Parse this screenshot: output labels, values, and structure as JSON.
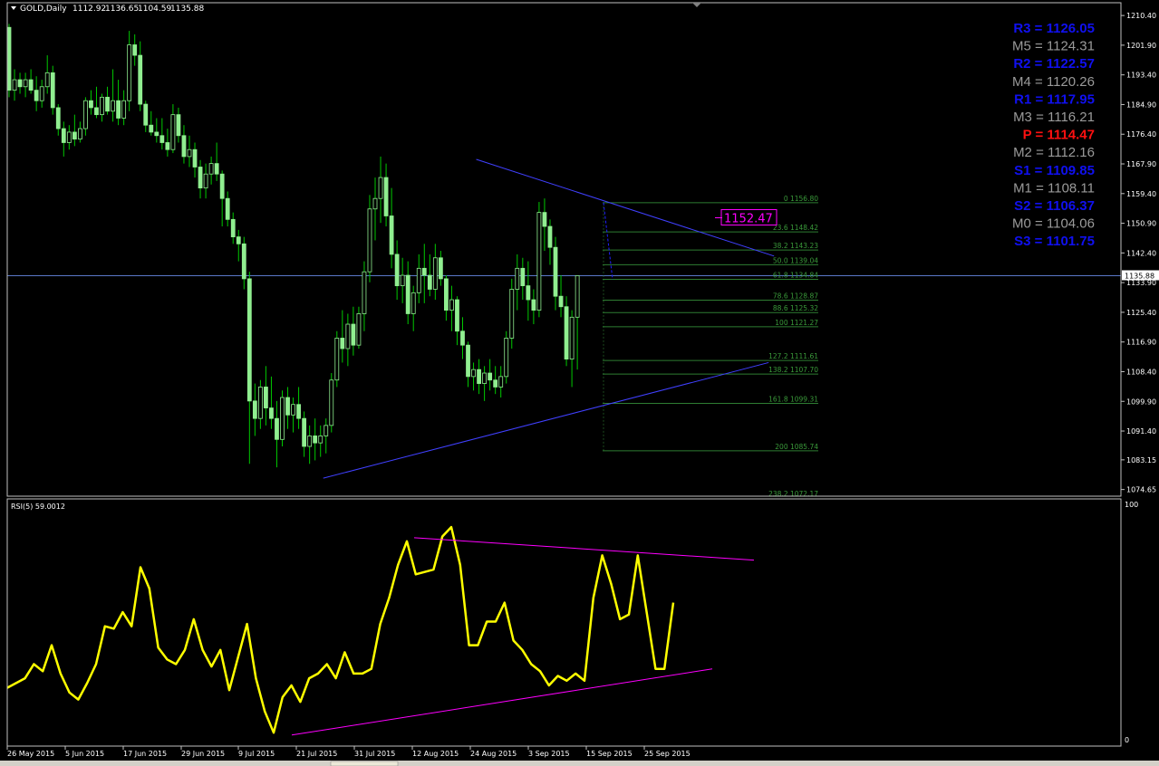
{
  "header": {
    "symbol": "GOLD,Daily",
    "open": "1112.92",
    "high": "1136.65",
    "low": "1104.59",
    "close": "1135.88"
  },
  "colors": {
    "background": "#000000",
    "frame": "#c0c0c0",
    "bull_candle_fill": "#000000",
    "bull_candle_border": "#90ee90",
    "bear_candle_fill": "#90ee90",
    "wick": "#00c800",
    "trendline": "#4040ff",
    "price_line": "#5a78c8",
    "fib": "#2e7d32",
    "fib_text": "#3a9a3a",
    "rsi_line": "#ffff00",
    "rsi_trendline": "#ff00ff",
    "pivot_blue": "#1010f0",
    "pivot_gray": "#9a9a9a",
    "pivot_red": "#ff1010"
  },
  "chart_data": {
    "type": "candlestick",
    "price_axis": {
      "range": [
        1073.0,
        1213.8
      ],
      "ticks": [
        "1210.40",
        "1201.90",
        "1193.40",
        "1184.90",
        "1176.40",
        "1167.90",
        "1159.40",
        "1150.90",
        "1142.40",
        "1133.90",
        "1125.40",
        "1116.90",
        "1108.40",
        "1099.90",
        "1091.40",
        "1083.15",
        "1074.65"
      ],
      "current_price_label": "1135.88"
    },
    "time_axis": {
      "labels": [
        "26 May 2015",
        "5 Jun 2015",
        "17 Jun 2015",
        "29 Jun 2015",
        "9 Jul 2015",
        "21 Jul 2015",
        "31 Jul 2015",
        "12 Aug 2015",
        "24 Aug 2015",
        "3 Sep 2015",
        "15 Sep 2015",
        "25 Sep 2015"
      ]
    },
    "candles": [
      [
        1207,
        1208,
        1187,
        1189
      ],
      [
        1189,
        1195,
        1186,
        1192
      ],
      [
        1192,
        1194,
        1188,
        1190
      ],
      [
        1190,
        1194,
        1187,
        1192
      ],
      [
        1192,
        1195,
        1188,
        1189
      ],
      [
        1189,
        1193,
        1183,
        1186
      ],
      [
        1186,
        1192,
        1184,
        1190
      ],
      [
        1190,
        1199,
        1188,
        1194
      ],
      [
        1194,
        1196,
        1182,
        1184
      ],
      [
        1184,
        1185,
        1176,
        1178
      ],
      [
        1178,
        1180,
        1170,
        1174
      ],
      [
        1174,
        1179,
        1172,
        1177
      ],
      [
        1177,
        1182,
        1173,
        1175
      ],
      [
        1175,
        1180,
        1174,
        1178
      ],
      [
        1178,
        1187,
        1176,
        1186
      ],
      [
        1186,
        1189,
        1182,
        1184
      ],
      [
        1184,
        1190,
        1181,
        1182
      ],
      [
        1182,
        1188,
        1180,
        1187
      ],
      [
        1187,
        1190,
        1182,
        1183
      ],
      [
        1183,
        1195,
        1180,
        1186
      ],
      [
        1186,
        1192,
        1179,
        1181
      ],
      [
        1181,
        1189,
        1179,
        1186
      ],
      [
        1186,
        1206,
        1183,
        1202
      ],
      [
        1202,
        1205,
        1196,
        1199
      ],
      [
        1199,
        1203,
        1183,
        1185
      ],
      [
        1185,
        1186,
        1177,
        1179
      ],
      [
        1179,
        1183,
        1176,
        1177
      ],
      [
        1177,
        1181,
        1174,
        1176
      ],
      [
        1176,
        1181,
        1172,
        1174
      ],
      [
        1174,
        1178,
        1170,
        1172
      ],
      [
        1172,
        1185,
        1171,
        1182
      ],
      [
        1182,
        1184,
        1174,
        1176
      ],
      [
        1176,
        1179,
        1168,
        1170
      ],
      [
        1170,
        1176,
        1167,
        1172
      ],
      [
        1172,
        1174,
        1164,
        1167
      ],
      [
        1167,
        1169,
        1158,
        1161
      ],
      [
        1161,
        1168,
        1158,
        1165
      ],
      [
        1165,
        1170,
        1162,
        1168
      ],
      [
        1168,
        1174,
        1163,
        1165
      ],
      [
        1165,
        1166,
        1150,
        1158
      ],
      [
        1158,
        1160,
        1150,
        1152
      ],
      [
        1152,
        1154,
        1145,
        1147
      ],
      [
        1147,
        1149,
        1140,
        1145
      ],
      [
        1145,
        1147,
        1132,
        1135
      ],
      [
        1135,
        1137,
        1082,
        1100
      ],
      [
        1100,
        1105,
        1090,
        1095
      ],
      [
        1095,
        1106,
        1092,
        1104
      ],
      [
        1104,
        1110,
        1093,
        1098
      ],
      [
        1098,
        1107,
        1092,
        1095
      ],
      [
        1095,
        1100,
        1081,
        1089
      ],
      [
        1089,
        1103,
        1087,
        1101
      ],
      [
        1101,
        1104,
        1092,
        1096
      ],
      [
        1096,
        1101,
        1091,
        1099
      ],
      [
        1099,
        1104,
        1092,
        1095
      ],
      [
        1095,
        1097,
        1084,
        1087
      ],
      [
        1087,
        1093,
        1082,
        1090
      ],
      [
        1090,
        1095,
        1083,
        1088
      ],
      [
        1088,
        1093,
        1084,
        1090
      ],
      [
        1090,
        1095,
        1085,
        1093
      ],
      [
        1093,
        1108,
        1091,
        1106
      ],
      [
        1106,
        1120,
        1104,
        1118
      ],
      [
        1118,
        1126,
        1111,
        1115
      ],
      [
        1115,
        1125,
        1110,
        1122
      ],
      [
        1122,
        1127,
        1113,
        1116
      ],
      [
        1116,
        1127,
        1115,
        1125
      ],
      [
        1125,
        1140,
        1120,
        1137
      ],
      [
        1137,
        1159,
        1134,
        1155
      ],
      [
        1155,
        1164,
        1146,
        1158
      ],
      [
        1158,
        1170,
        1151,
        1164
      ],
      [
        1164,
        1168,
        1150,
        1153
      ],
      [
        1153,
        1161,
        1138,
        1142
      ],
      [
        1142,
        1146,
        1129,
        1133
      ],
      [
        1133,
        1141,
        1128,
        1136
      ],
      [
        1136,
        1140,
        1122,
        1125
      ],
      [
        1125,
        1133,
        1120,
        1131
      ],
      [
        1131,
        1142,
        1128,
        1138
      ],
      [
        1138,
        1145,
        1128,
        1136
      ],
      [
        1136,
        1142,
        1130,
        1132
      ],
      [
        1132,
        1145,
        1129,
        1141
      ],
      [
        1141,
        1143,
        1133,
        1135
      ],
      [
        1135,
        1136,
        1123,
        1126
      ],
      [
        1126,
        1133,
        1120,
        1129
      ],
      [
        1129,
        1130,
        1116,
        1120
      ],
      [
        1120,
        1124,
        1112,
        1116
      ],
      [
        1116,
        1117,
        1104,
        1107
      ],
      [
        1107,
        1111,
        1103,
        1109
      ],
      [
        1109,
        1112,
        1102,
        1105
      ],
      [
        1105,
        1110,
        1100,
        1108
      ],
      [
        1108,
        1112,
        1103,
        1106
      ],
      [
        1106,
        1110,
        1102,
        1104
      ],
      [
        1104,
        1110,
        1101,
        1107
      ],
      [
        1107,
        1120,
        1105,
        1118
      ],
      [
        1118,
        1135,
        1115,
        1132
      ],
      [
        1132,
        1142,
        1126,
        1138
      ],
      [
        1138,
        1141,
        1129,
        1133
      ],
      [
        1133,
        1140,
        1123,
        1129
      ],
      [
        1129,
        1132,
        1122,
        1126
      ],
      [
        1126,
        1157,
        1124,
        1154
      ],
      [
        1154,
        1158,
        1143,
        1150
      ],
      [
        1150,
        1152,
        1139,
        1144
      ],
      [
        1144,
        1147,
        1126,
        1130
      ],
      [
        1130,
        1136,
        1124,
        1127
      ],
      [
        1127,
        1130,
        1110,
        1112
      ],
      [
        1112,
        1126,
        1104,
        1124
      ],
      [
        1124,
        1136,
        1109,
        1135.88
      ]
    ],
    "annotations": {
      "price_label": "1152.47",
      "fibonacci": [
        {
          "label": "0 1156.80",
          "price": 1156.8
        },
        {
          "label": "23.6 1148.42",
          "price": 1148.42
        },
        {
          "label": "38.2 1143.23",
          "price": 1143.23
        },
        {
          "label": "50.0 1139.04",
          "price": 1139.04
        },
        {
          "label": "61.8 1134.84",
          "price": 1134.84
        },
        {
          "label": "78.6 1128.87",
          "price": 1128.87
        },
        {
          "label": "88.6 1125.32",
          "price": 1125.32
        },
        {
          "label": "100 1121.27",
          "price": 1121.27
        },
        {
          "label": "127.2 1111.61",
          "price": 1111.61
        },
        {
          "label": "138.2 1107.70",
          "price": 1107.7
        },
        {
          "label": "161.8 1099.31",
          "price": 1099.31
        },
        {
          "label": "200 1085.74",
          "price": 1085.74
        },
        {
          "label": "238.2 1072.17",
          "price": 1072.17
        }
      ]
    },
    "pivots": [
      {
        "name": "R3",
        "value": "1126.05",
        "color": "blue"
      },
      {
        "name": "M5",
        "value": "1124.31",
        "color": "gray"
      },
      {
        "name": "R2",
        "value": "1122.57",
        "color": "blue"
      },
      {
        "name": "M4",
        "value": "1120.26",
        "color": "gray"
      },
      {
        "name": "R1",
        "value": "1117.95",
        "color": "blue"
      },
      {
        "name": "M3",
        "value": "1116.21",
        "color": "gray"
      },
      {
        "name": "P",
        "value": "1114.47",
        "color": "red"
      },
      {
        "name": "M2",
        "value": "1112.16",
        "color": "gray"
      },
      {
        "name": "S1",
        "value": "1109.85",
        "color": "blue"
      },
      {
        "name": "M1",
        "value": "1108.11",
        "color": "gray"
      },
      {
        "name": "S2",
        "value": "1106.37",
        "color": "blue"
      },
      {
        "name": "M0",
        "value": "1104.06",
        "color": "gray"
      },
      {
        "name": "S3",
        "value": "1101.75",
        "color": "blue"
      }
    ],
    "rsi": {
      "label": "RSI(5) 59.0012",
      "axis_max": "100",
      "axis_min": "0",
      "values": [
        22,
        24,
        26,
        32,
        29,
        40,
        28,
        20,
        17,
        24,
        32,
        48,
        47,
        54,
        48,
        73,
        64,
        39,
        34,
        32,
        38,
        51,
        38,
        31,
        38,
        21,
        35,
        49,
        26,
        12,
        3,
        18,
        23,
        16,
        26,
        28,
        32,
        26,
        37,
        28,
        28,
        30,
        49,
        60,
        74,
        84,
        70,
        71,
        72,
        86,
        90,
        74,
        40,
        40,
        50,
        50,
        58,
        42,
        38,
        32,
        29,
        23,
        27,
        25,
        28,
        25,
        60,
        78,
        66,
        51,
        53,
        78,
        54,
        30,
        30,
        58
      ]
    }
  }
}
